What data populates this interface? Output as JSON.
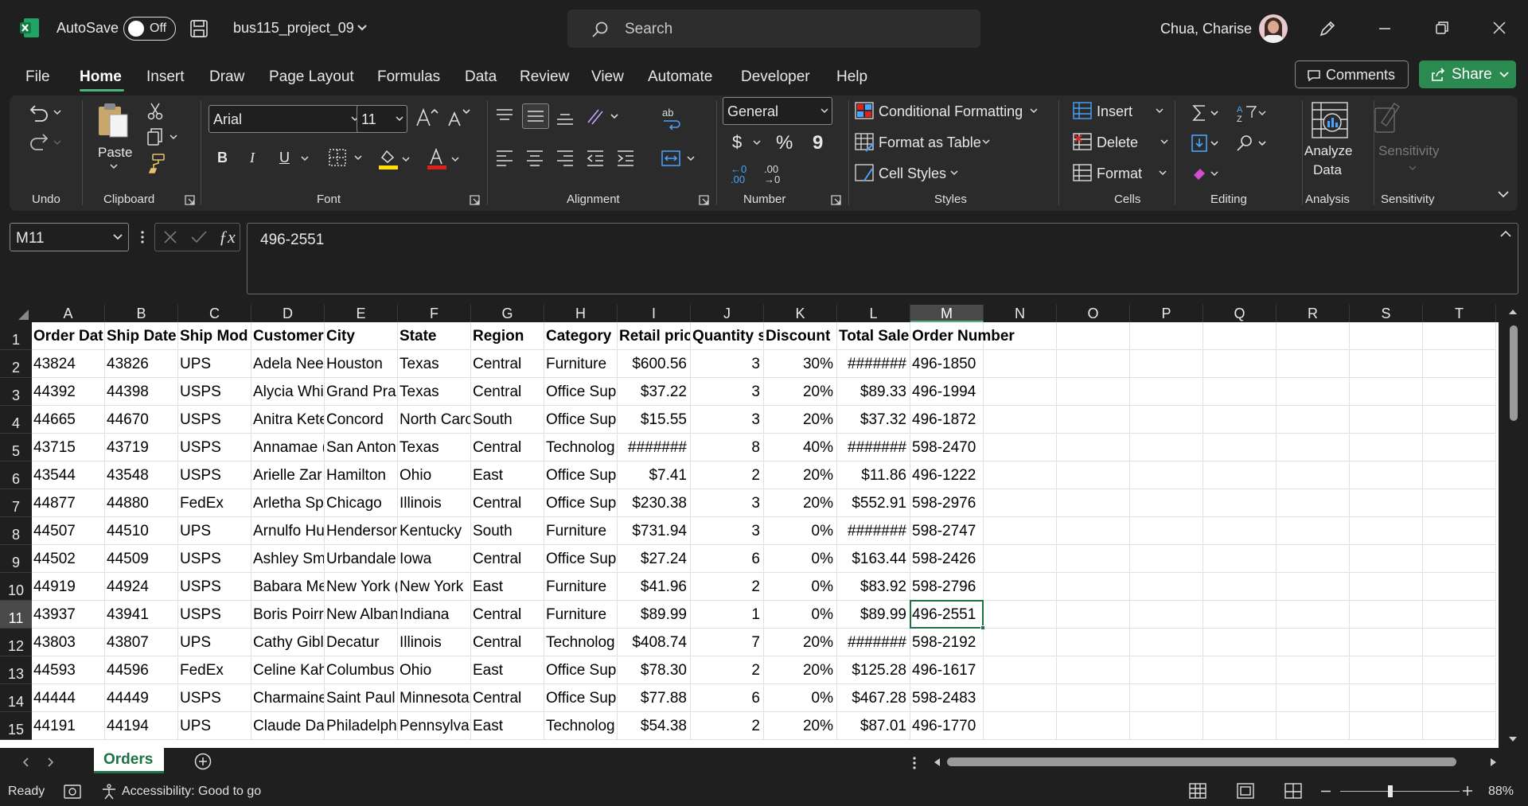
{
  "titlebar": {
    "autosave_label": "AutoSave",
    "autosave_state": "Off",
    "filename": "bus115_project_09",
    "search_placeholder": "Search",
    "user_name": "Chua, Charise"
  },
  "menu": [
    "File",
    "Home",
    "Insert",
    "Draw",
    "Page Layout",
    "Formulas",
    "Data",
    "Review",
    "View",
    "Automate",
    "Developer",
    "Help"
  ],
  "menu_active": "Home",
  "actions": {
    "comments": "Comments",
    "share": "Share"
  },
  "ribbon": {
    "groups": {
      "undo": "Undo",
      "clipboard": "Clipboard",
      "font": "Font",
      "alignment": "Alignment",
      "number": "Number",
      "styles": "Styles",
      "cells": "Cells",
      "editing": "Editing",
      "analysis": "Analysis",
      "sensitivity": "Sensitivity"
    },
    "paste": "Paste",
    "font_name": "Arial",
    "font_size": "11",
    "bold": "B",
    "italic": "I",
    "underline": "U",
    "number_format": "General",
    "currency": "$",
    "percent": "%",
    "comma": "9",
    "inc_decimal": "←0 .00",
    "dec_decimal": ".00 →0",
    "conditional_formatting": "Conditional Formatting",
    "format_as_table": "Format as Table",
    "cell_styles": "Cell Styles",
    "insert": "Insert",
    "delete": "Delete",
    "format": "Format",
    "analyze_data_1": "Analyze",
    "analyze_data_2": "Data",
    "sensitivity_btn": "Sensitivity"
  },
  "formula_bar": {
    "name_box": "M11",
    "content": "496-2551"
  },
  "columns": [
    "A",
    "B",
    "C",
    "D",
    "E",
    "F",
    "G",
    "H",
    "I",
    "J",
    "K",
    "L",
    "M",
    "N",
    "O",
    "P",
    "Q",
    "R",
    "S",
    "T"
  ],
  "selected_column": "M",
  "selected_row": "11",
  "rows": [
    {
      "n": "1",
      "cells": [
        "Order Dat",
        "Ship Date",
        "Ship Mod",
        "Customer",
        "City",
        "State",
        "Region",
        "Category",
        "Retail pric",
        "Quantity s",
        "Discount",
        "Total Sale",
        "Order Number"
      ]
    },
    {
      "n": "2",
      "cells": [
        "43824",
        "43826",
        "UPS",
        "Adela Nee",
        "Houston",
        "Texas",
        "Central",
        "Furniture",
        "$600.56",
        "3",
        "30%",
        "#######",
        "496-1850"
      ]
    },
    {
      "n": "3",
      "cells": [
        "44392",
        "44398",
        "USPS",
        "Alycia Whi",
        "Grand Pra",
        "Texas",
        "Central",
        "Office Sup",
        "$37.22",
        "3",
        "20%",
        "$89.33",
        "496-1994"
      ]
    },
    {
      "n": "4",
      "cells": [
        "44665",
        "44670",
        "USPS",
        "Anitra Kete",
        "Concord",
        "North Caro",
        "South",
        "Office Sup",
        "$15.55",
        "3",
        "20%",
        "$37.32",
        "496-1872"
      ]
    },
    {
      "n": "5",
      "cells": [
        "43715",
        "43719",
        "USPS",
        "Annamae (",
        "San Anton",
        "Texas",
        "Central",
        "Technolog",
        "#######",
        "8",
        "40%",
        "#######",
        "598-2470"
      ]
    },
    {
      "n": "6",
      "cells": [
        "43544",
        "43548",
        "USPS",
        "Arielle Zar",
        "Hamilton",
        "Ohio",
        "East",
        "Office Sup",
        "$7.41",
        "2",
        "20%",
        "$11.86",
        "496-1222"
      ]
    },
    {
      "n": "7",
      "cells": [
        "44877",
        "44880",
        "FedEx",
        "Arletha Sp",
        "Chicago",
        "Illinois",
        "Central",
        "Office Sup",
        "$230.38",
        "3",
        "20%",
        "$552.91",
        "598-2976"
      ]
    },
    {
      "n": "8",
      "cells": [
        "44507",
        "44510",
        "UPS",
        "Arnulfo Hu",
        "Hendersor",
        "Kentucky",
        "South",
        "Furniture",
        "$731.94",
        "3",
        "0%",
        "#######",
        "598-2747"
      ]
    },
    {
      "n": "9",
      "cells": [
        "44502",
        "44509",
        "USPS",
        "Ashley Sm",
        "Urbandale",
        "Iowa",
        "Central",
        "Office Sup",
        "$27.24",
        "6",
        "0%",
        "$163.44",
        "598-2426"
      ]
    },
    {
      "n": "10",
      "cells": [
        "44919",
        "44924",
        "USPS",
        "Babara Me",
        "New York (",
        "New York",
        "East",
        "Furniture",
        "$41.96",
        "2",
        "0%",
        "$83.92",
        "598-2796"
      ]
    },
    {
      "n": "11",
      "cells": [
        "43937",
        "43941",
        "USPS",
        "Boris Poirr",
        "New Alban",
        "Indiana",
        "Central",
        "Furniture",
        "$89.99",
        "1",
        "0%",
        "$89.99",
        "496-2551"
      ]
    },
    {
      "n": "12",
      "cells": [
        "43803",
        "43807",
        "UPS",
        "Cathy Gibl",
        "Decatur",
        "Illinois",
        "Central",
        "Technolog",
        "$408.74",
        "7",
        "20%",
        "#######",
        "598-2192"
      ]
    },
    {
      "n": "13",
      "cells": [
        "44593",
        "44596",
        "FedEx",
        "Celine Kah",
        "Columbus",
        "Ohio",
        "East",
        "Office Sup",
        "$78.30",
        "2",
        "20%",
        "$125.28",
        "496-1617"
      ]
    },
    {
      "n": "14",
      "cells": [
        "44444",
        "44449",
        "USPS",
        "Charmaine",
        "Saint Paul",
        "Minnesota",
        "Central",
        "Office Sup",
        "$77.88",
        "6",
        "0%",
        "$467.28",
        "598-2483"
      ]
    },
    {
      "n": "15",
      "cells": [
        "44191",
        "44194",
        "UPS",
        "Claude Da",
        "Philadelph",
        "Pennsylva",
        "East",
        "Technolog",
        "$54.38",
        "2",
        "20%",
        "$87.01",
        "496-1770"
      ]
    }
  ],
  "sheet_tab": "Orders",
  "status": {
    "ready": "Ready",
    "accessibility": "Accessibility: Good to go",
    "zoom": "88%"
  },
  "colors": {
    "accent": "#1e7145",
    "share": "#2b8a4f",
    "tab_underline": "#4fb37b"
  }
}
